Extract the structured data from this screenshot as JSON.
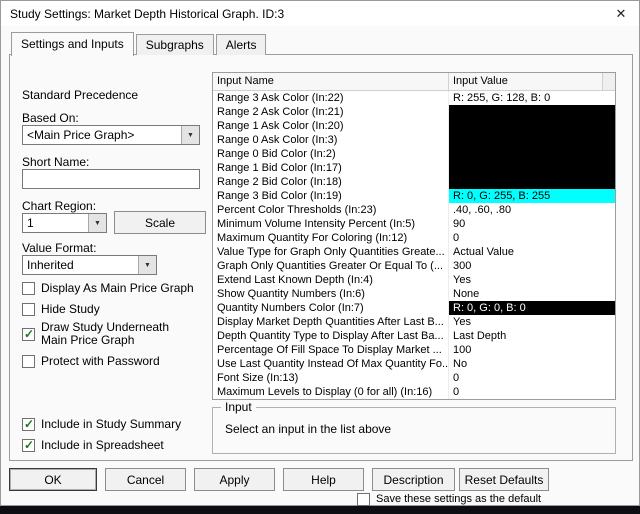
{
  "window": {
    "title": "Study Settings: Market Depth Historical Graph. ID:3",
    "close_glyph": "✕"
  },
  "tabs": [
    {
      "label": "Settings and Inputs",
      "active": true
    },
    {
      "label": "Subgraphs",
      "active": false
    },
    {
      "label": "Alerts",
      "active": false
    }
  ],
  "left": {
    "standard_precedence": "Standard Precedence",
    "based_on_label": "Based On:",
    "based_on_value": "<Main Price Graph>",
    "short_name_label": "Short Name:",
    "short_name_value": "",
    "chart_region_label": "Chart Region:",
    "chart_region_value": "1",
    "scale_button": "Scale",
    "value_format_label": "Value Format:",
    "value_format_value": "Inherited",
    "checkboxes": [
      {
        "label": "Display As Main Price Graph",
        "checked": false
      },
      {
        "label": "Hide Study",
        "checked": false
      },
      {
        "label": "Draw Study Underneath Main Price Graph",
        "checked": true
      },
      {
        "label": "Protect with Password",
        "checked": false
      }
    ],
    "summary_checkboxes": [
      {
        "label": "Include in Study Summary",
        "checked": true
      },
      {
        "label": "Include in Spreadsheet",
        "checked": true
      }
    ]
  },
  "inputs_table": {
    "columns": [
      "Input Name",
      "Input Value"
    ],
    "rows": [
      {
        "name": "Range 3 Ask Color  (In:22)",
        "value": "R: 255, G: 128, B: 0"
      },
      {
        "name": "Range 2 Ask Color  (In:21)",
        "value": "",
        "bg": "#000000",
        "fg": "#000000"
      },
      {
        "name": "Range 1 Ask Color  (In:20)",
        "value": "",
        "bg": "#000000",
        "fg": "#000000"
      },
      {
        "name": "Range 0 Ask Color  (In:3)",
        "value": "",
        "bg": "#000000",
        "fg": "#000000"
      },
      {
        "name": "Range 0 Bid Color  (In:2)",
        "value": "",
        "bg": "#000000",
        "fg": "#000000"
      },
      {
        "name": "Range 1 Bid Color  (In:17)",
        "value": "",
        "bg": "#000000",
        "fg": "#000000"
      },
      {
        "name": "Range 2 Bid Color  (In:18)",
        "value": "",
        "bg": "#000000",
        "fg": "#000000"
      },
      {
        "name": "Range 3 Bid Color  (In:19)",
        "value": "R: 0, G: 255, B: 255",
        "bg": "#00FFFF",
        "fg": "#000000"
      },
      {
        "name": "Percent Color Thresholds  (In:23)",
        "value": ".40, .60, .80"
      },
      {
        "name": "Minimum Volume Intensity Percent  (In:5)",
        "value": "90"
      },
      {
        "name": "Maximum Quantity For Coloring  (In:12)",
        "value": "0"
      },
      {
        "name": "Value Type for Graph Only Quantities Greate...",
        "value": "Actual Value"
      },
      {
        "name": "Graph Only Quantities Greater Or Equal To  (...",
        "value": "300"
      },
      {
        "name": "Extend Last Known Depth  (In:4)",
        "value": "Yes"
      },
      {
        "name": "Show Quantity Numbers  (In:6)",
        "value": "None"
      },
      {
        "name": "Quantity Numbers Color  (In:7)",
        "value": "R: 0, G: 0, B: 0",
        "bg": "#000000",
        "fg": "#FFFFFF"
      },
      {
        "name": "Display Market Depth Quantities After Last B...",
        "value": "Yes"
      },
      {
        "name": "Depth Quantity Type to Display After Last Ba...",
        "value": "Last Depth"
      },
      {
        "name": "Percentage Of Fill Space To Display Market ...",
        "value": "100"
      },
      {
        "name": "Use Last Quantity Instead Of Max Quantity Fo...",
        "value": "No"
      },
      {
        "name": "Font Size  (In:13)",
        "value": "0"
      },
      {
        "name": "Maximum Levels to Display (0 for all)  (In:16)",
        "value": "0"
      }
    ]
  },
  "input_group": {
    "title": "Input",
    "message": "Select an input in the list above"
  },
  "buttons": [
    "OK",
    "Cancel",
    "Apply",
    "Help",
    "Description",
    "Reset Defaults"
  ],
  "save_default": {
    "label": "Save these settings as the default",
    "checked": false
  }
}
